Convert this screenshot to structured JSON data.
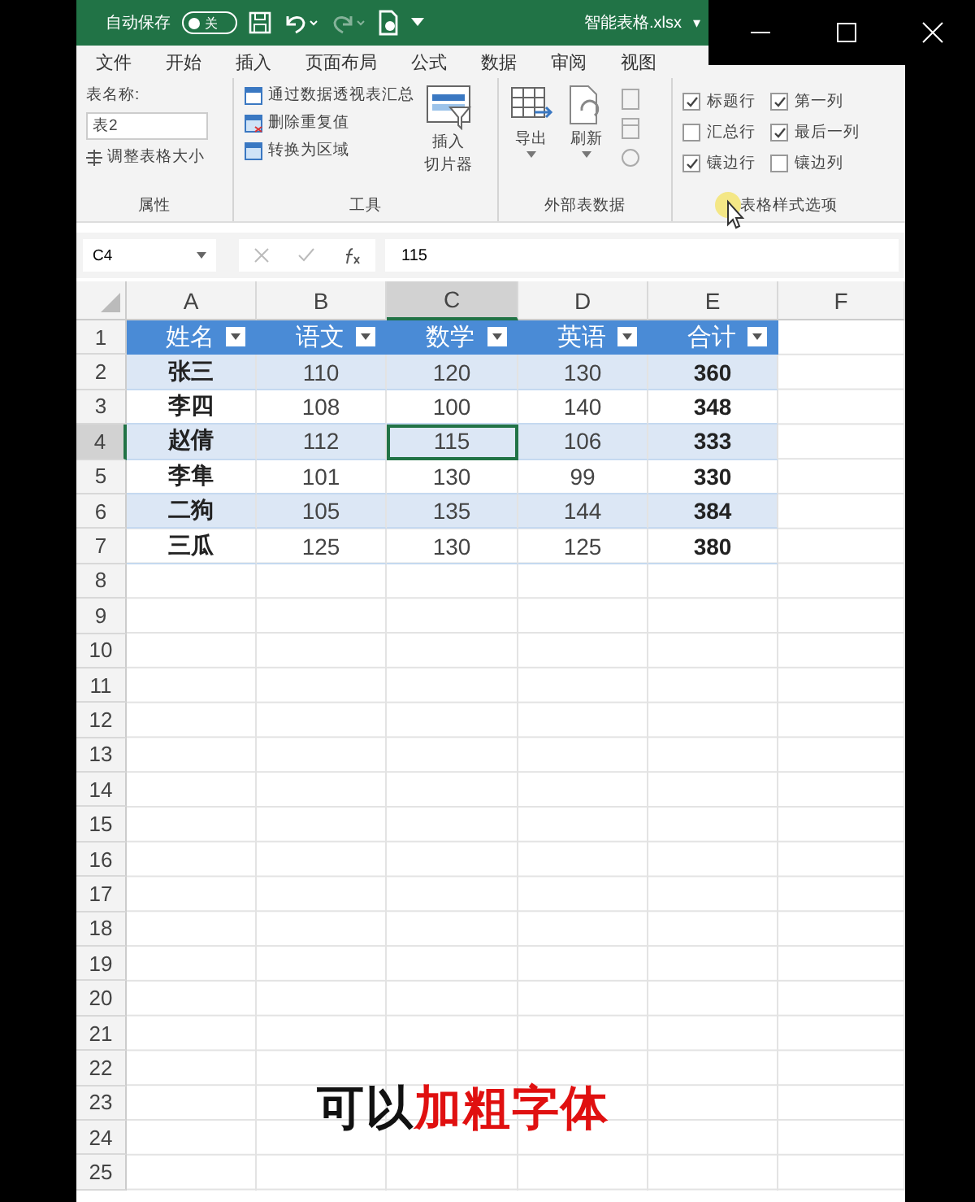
{
  "title_bar": {
    "autosave_label": "自动保存",
    "autosave_on": false,
    "autosave_state": "关",
    "filename": "智能表格.xlsx",
    "filename_caret": "▾"
  },
  "ribbon_tabs": [
    "文件",
    "开始",
    "插入",
    "页面布局",
    "公式",
    "数据",
    "审阅",
    "视图"
  ],
  "ribbon_groups": {
    "properties": {
      "name_label": "表名称:",
      "name_value": "表2",
      "resize": "调整表格大小",
      "title": "属性"
    },
    "tools": {
      "items": [
        "通过数据透视表汇总",
        "删除重复值",
        "转换为区域"
      ],
      "slicer_lines": [
        "插入",
        "切片器"
      ],
      "title": "工具"
    },
    "external": {
      "export": "导出",
      "refresh": "刷新",
      "title": "外部表数据"
    },
    "style_options": {
      "options": [
        {
          "label": "标题行",
          "checked": true
        },
        {
          "label": "第一列",
          "checked": true
        },
        {
          "label": "汇总行",
          "checked": false
        },
        {
          "label": "最后一列",
          "checked": true
        },
        {
          "label": "镶边行",
          "checked": true
        },
        {
          "label": "镶边列",
          "checked": false
        }
      ],
      "title": "表格样式选项"
    }
  },
  "formula_bar": {
    "name_box": "C4",
    "formula": "115"
  },
  "columns": [
    {
      "label": "A",
      "selected": false
    },
    {
      "label": "B",
      "selected": false
    },
    {
      "label": "C",
      "selected": true
    },
    {
      "label": "D",
      "selected": false
    },
    {
      "label": "E",
      "selected": false
    },
    {
      "label": "F",
      "selected": false
    }
  ],
  "row_numbers": [
    {
      "label": "1",
      "selected": false
    },
    {
      "label": "2",
      "selected": false
    },
    {
      "label": "3",
      "selected": false
    },
    {
      "label": "4",
      "selected": true
    },
    {
      "label": "5",
      "selected": false
    },
    {
      "label": "6",
      "selected": false
    },
    {
      "label": "7",
      "selected": false
    },
    {
      "label": "8",
      "selected": false
    },
    {
      "label": "9",
      "selected": false
    },
    {
      "label": "10",
      "selected": false
    },
    {
      "label": "11",
      "selected": false
    },
    {
      "label": "12",
      "selected": false
    },
    {
      "label": "13",
      "selected": false
    },
    {
      "label": "14",
      "selected": false
    },
    {
      "label": "15",
      "selected": false
    },
    {
      "label": "16",
      "selected": false
    },
    {
      "label": "17",
      "selected": false
    },
    {
      "label": "18",
      "selected": false
    },
    {
      "label": "19",
      "selected": false
    },
    {
      "label": "20",
      "selected": false
    },
    {
      "label": "21",
      "selected": false
    },
    {
      "label": "22",
      "selected": false
    },
    {
      "label": "23",
      "selected": false
    },
    {
      "label": "24",
      "selected": false
    },
    {
      "label": "25",
      "selected": false
    }
  ],
  "table": {
    "headers": [
      "姓名",
      "语文",
      "数学",
      "英语",
      "合计"
    ],
    "rows": [
      {
        "banded": true,
        "cells": [
          {
            "text": "张三",
            "selected": false
          },
          {
            "text": "110",
            "selected": false
          },
          {
            "text": "120",
            "selected": false
          },
          {
            "text": "130",
            "selected": false
          },
          {
            "text": "360",
            "selected": false
          }
        ]
      },
      {
        "banded": false,
        "cells": [
          {
            "text": "李四",
            "selected": false
          },
          {
            "text": "108",
            "selected": false
          },
          {
            "text": "100",
            "selected": false
          },
          {
            "text": "140",
            "selected": false
          },
          {
            "text": "348",
            "selected": false
          }
        ]
      },
      {
        "banded": true,
        "cells": [
          {
            "text": "赵倩",
            "selected": false
          },
          {
            "text": "112",
            "selected": false
          },
          {
            "text": "115",
            "selected": true
          },
          {
            "text": "106",
            "selected": false
          },
          {
            "text": "333",
            "selected": false
          }
        ]
      },
      {
        "banded": false,
        "cells": [
          {
            "text": "李隼",
            "selected": false
          },
          {
            "text": "101",
            "selected": false
          },
          {
            "text": "130",
            "selected": false
          },
          {
            "text": "99",
            "selected": false
          },
          {
            "text": "330",
            "selected": false
          }
        ]
      },
      {
        "banded": true,
        "cells": [
          {
            "text": "二狗",
            "selected": false
          },
          {
            "text": "105",
            "selected": false
          },
          {
            "text": "135",
            "selected": false
          },
          {
            "text": "144",
            "selected": false
          },
          {
            "text": "384",
            "selected": false
          }
        ]
      },
      {
        "banded": false,
        "cells": [
          {
            "text": "三瓜",
            "selected": false
          },
          {
            "text": "125",
            "selected": false
          },
          {
            "text": "130",
            "selected": false
          },
          {
            "text": "125",
            "selected": false
          },
          {
            "text": "380",
            "selected": false
          }
        ]
      }
    ]
  },
  "caption": {
    "text": "可以",
    "highlight": "加粗字体"
  }
}
